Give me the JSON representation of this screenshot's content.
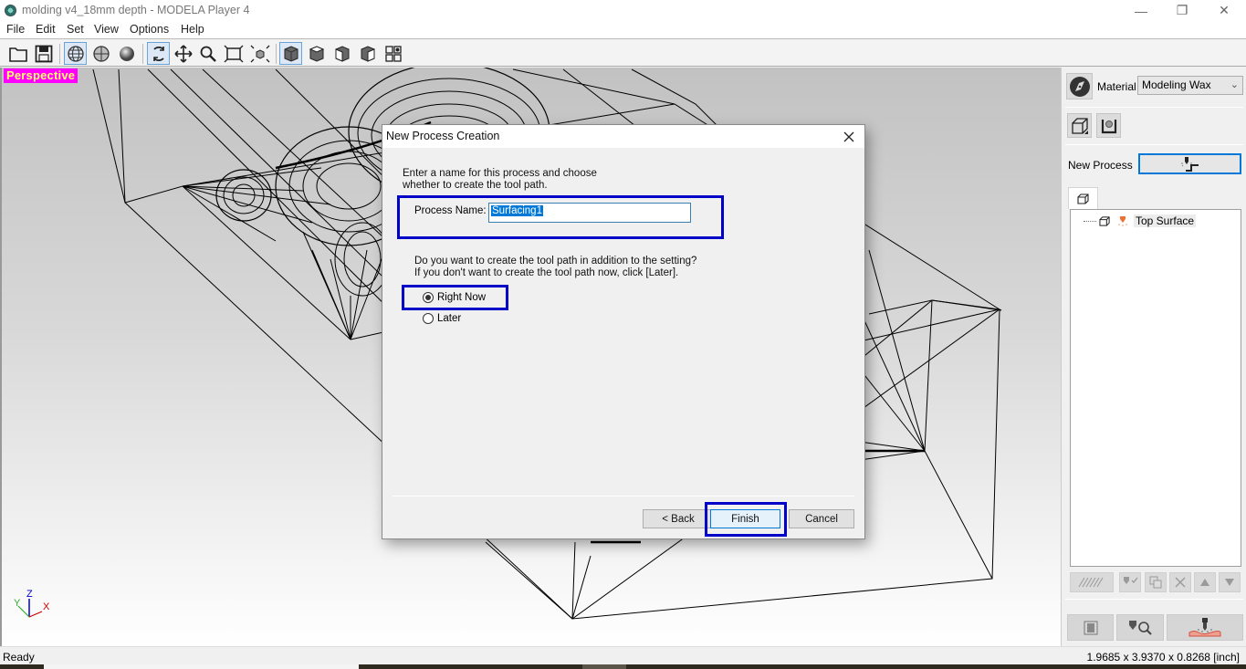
{
  "window": {
    "title": "molding v4_18mm depth  - MODELA Player 4",
    "controls": {
      "minimize": "—",
      "maximize": "❐",
      "close": "✕"
    }
  },
  "menu": [
    "File",
    "Edit",
    "Set",
    "View",
    "Options",
    "Help"
  ],
  "toolbar": {
    "buttons": [
      {
        "name": "open-folder-icon",
        "active": false
      },
      {
        "name": "save-icon",
        "active": false
      },
      {
        "name": "wireframe-view-icon",
        "active": true
      },
      {
        "name": "polygon-view-icon",
        "active": false
      },
      {
        "name": "shaded-view-icon",
        "active": false
      },
      {
        "name": "rotate-icon",
        "active": true
      },
      {
        "name": "pan-icon",
        "active": false
      },
      {
        "name": "zoom-icon",
        "active": false
      },
      {
        "name": "fit-window-icon",
        "active": false
      },
      {
        "name": "zoom-object-icon",
        "active": false
      },
      {
        "name": "perspective-view-icon",
        "active": true
      },
      {
        "name": "top-view-icon",
        "active": false
      },
      {
        "name": "front-view-icon",
        "active": false
      },
      {
        "name": "side-view-icon",
        "active": false
      },
      {
        "name": "multi-view-icon",
        "active": false
      }
    ]
  },
  "viewport": {
    "label": "Perspective",
    "axes": {
      "x": "X",
      "y": "Y",
      "z": "Z"
    },
    "colors": {
      "label_bg": "#ff00ff",
      "label_fg": "#ffff66",
      "x": "#cc0000",
      "y": "#33aa33",
      "z": "#0000cc"
    }
  },
  "dialog": {
    "title": "New Process Creation",
    "intro_line1": "Enter a name for this process and choose",
    "intro_line2": "whether to create the tool path.",
    "process_name_label": "Process Name:",
    "process_name_value": "Surfacing1",
    "question_line1": "Do you want to create the tool path in addition to the setting?",
    "question_line2": "If you don't want to create the tool path now, click [Later].",
    "options": [
      {
        "label": "Right Now",
        "selected": true
      },
      {
        "label": "Later",
        "selected": false
      }
    ],
    "buttons": {
      "back": "< Back",
      "finish": "Finish",
      "cancel": "Cancel"
    },
    "highlight_color": "#0000c8"
  },
  "right_panel": {
    "material_label": "Material",
    "material_value": "Modeling Wax",
    "new_process_label": "New Process",
    "tree": [
      {
        "label": "Top Surface"
      }
    ]
  },
  "status": {
    "left": "Ready",
    "right": "1.9685 x 3.9370 x 0.8268 [inch]"
  }
}
